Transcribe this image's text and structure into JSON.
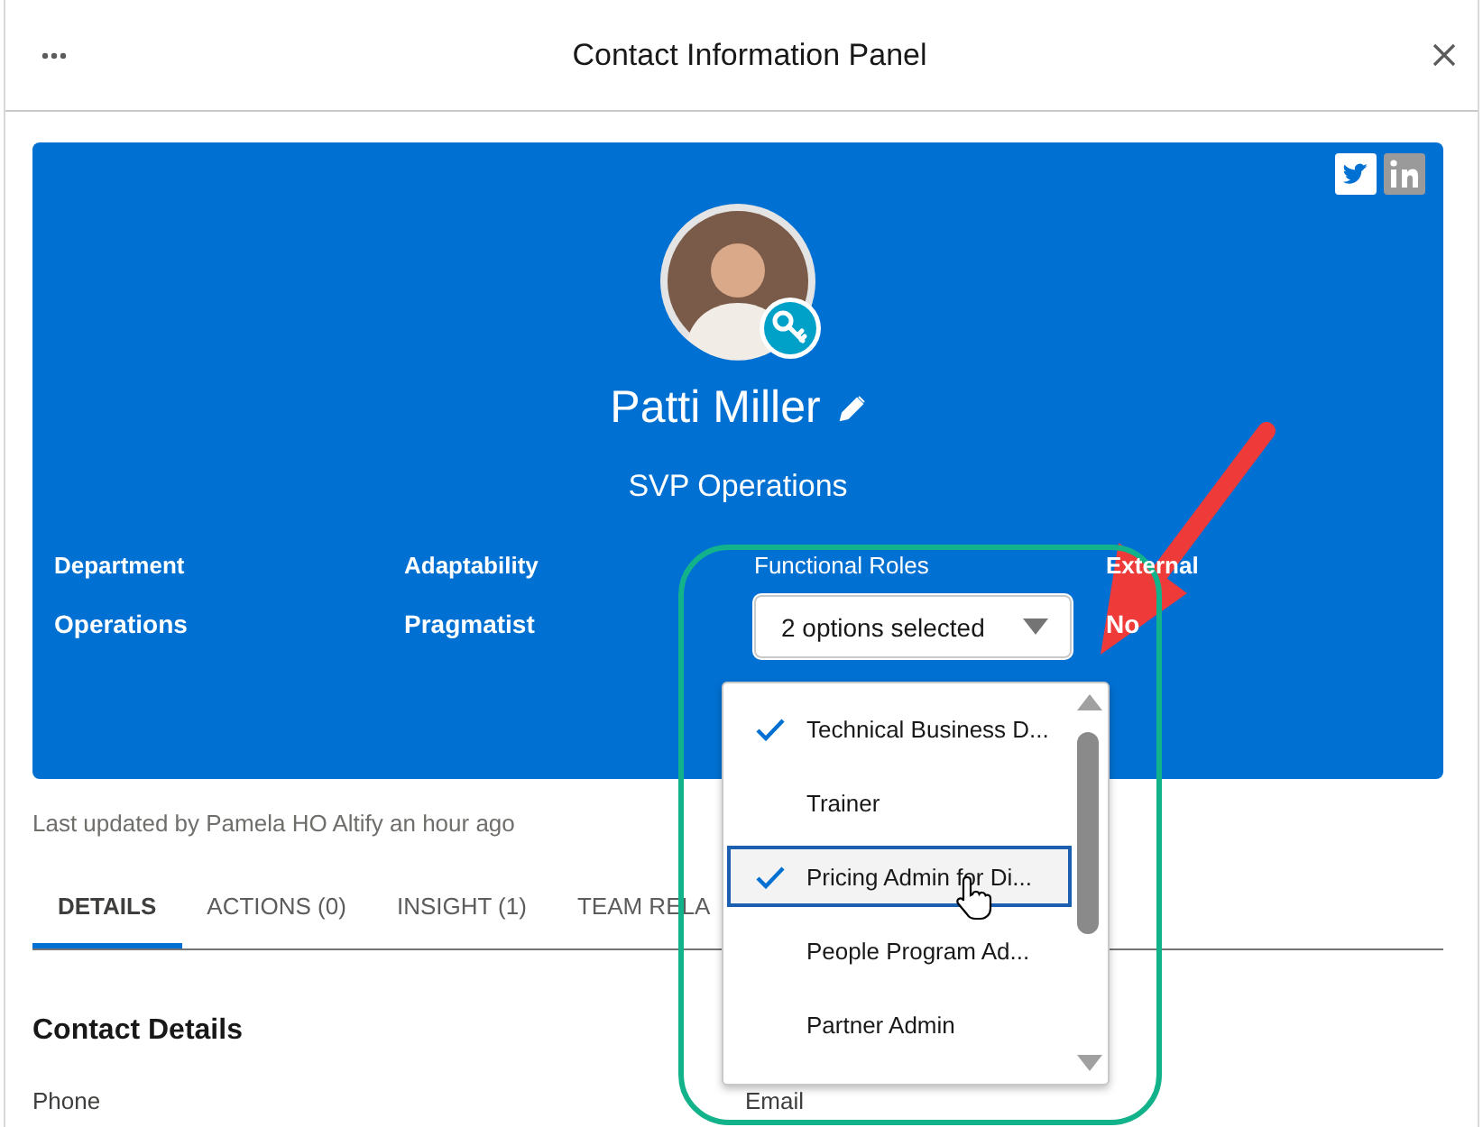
{
  "header": {
    "title": "Contact Information Panel"
  },
  "profile": {
    "name": "Patti Miller",
    "title": "SVP Operations"
  },
  "fields": [
    {
      "kind": "text",
      "label": "Department",
      "value": "Operations"
    },
    {
      "kind": "text",
      "label": "Adaptability",
      "value": "Pragmatist"
    },
    {
      "kind": "multiselect",
      "label": "Functional Roles",
      "value": "2 options selected",
      "expanded": true
    },
    {
      "kind": "text",
      "label": "External",
      "value": "No"
    }
  ],
  "dropdown_options": [
    {
      "label": "Technical Business D...",
      "checked": true,
      "highlighted": false
    },
    {
      "label": "Trainer",
      "checked": false,
      "highlighted": false
    },
    {
      "label": "Pricing Admin for Di...",
      "checked": true,
      "highlighted": true
    },
    {
      "label": "People Program Ad...",
      "checked": false,
      "highlighted": false
    },
    {
      "label": "Partner Admin",
      "checked": false,
      "highlighted": false
    }
  ],
  "last_updated": "Last updated by Pamela HO Altify an hour ago",
  "tabs": [
    {
      "label": "DETAILS",
      "selected": true
    },
    {
      "label": "ACTIONS (0)",
      "selected": false
    },
    {
      "label": "INSIGHT (1)",
      "selected": false
    },
    {
      "label": "TEAM RELA",
      "selected": false
    }
  ],
  "section": {
    "title": "Contact Details",
    "fields": [
      {
        "label": "Phone"
      },
      {
        "label": "Email"
      }
    ]
  }
}
